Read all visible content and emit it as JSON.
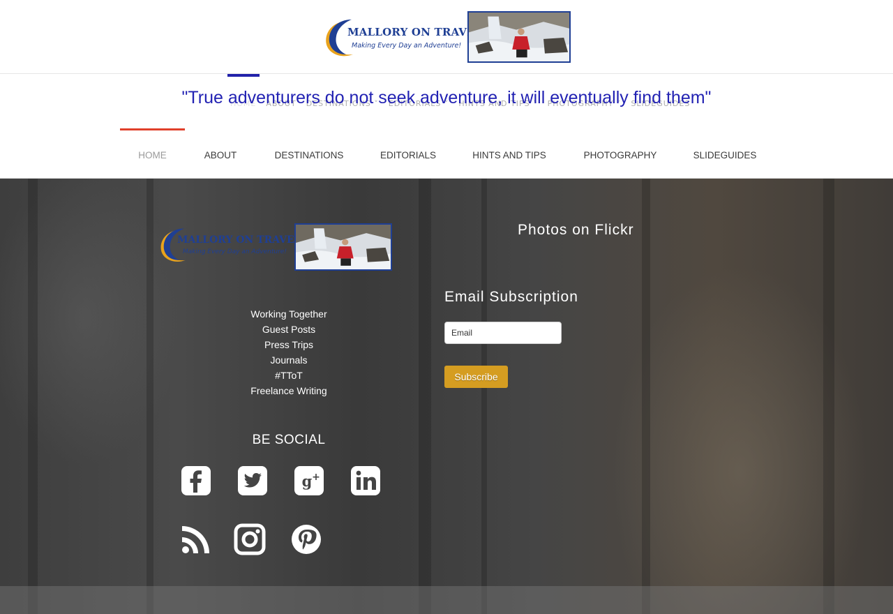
{
  "header": {
    "logo_title": "MALLORY ON TRAVEL",
    "logo_tagline": "Making Every Day an Adventure!",
    "quote": "\"True adventurers do not seek adventure, it will eventually find them\""
  },
  "ghost_nav": [
    "HOME",
    "ABOUT",
    "DESTINATIONS ˅",
    "EDITORIALS ˅",
    "HINTS AND TIPS ˅",
    "PHOTOGRAPHY ˅",
    "SLIDEGUIDES"
  ],
  "nav": {
    "items": [
      {
        "label": "HOME",
        "active": true
      },
      {
        "label": "ABOUT"
      },
      {
        "label": "DESTINATIONS"
      },
      {
        "label": "EDITORIALS"
      },
      {
        "label": "HINTS AND TIPS"
      },
      {
        "label": "PHOTOGRAPHY"
      },
      {
        "label": "SLIDEGUIDES"
      }
    ],
    "active_color": "#e0402b"
  },
  "footer": {
    "logo_title": "MALLORY ON TRAVEL",
    "logo_tagline": "Making Every Day an Adventure!",
    "links": [
      "Working Together",
      "Guest Posts",
      "Press Trips",
      "Journals",
      "#TToT",
      "Freelance Writing"
    ],
    "be_social": "BE SOCIAL",
    "social_icons": [
      "facebook-icon",
      "twitter-icon",
      "google-plus-icon",
      "linkedin-icon",
      "rss-icon",
      "instagram-icon",
      "pinterest-icon"
    ],
    "flickr_title": "Photos on Flickr",
    "email_title": "Email Subscription",
    "email_placeholder": "Email",
    "subscribe_label": "Subscribe",
    "subscribe_color": "#d59d21"
  }
}
